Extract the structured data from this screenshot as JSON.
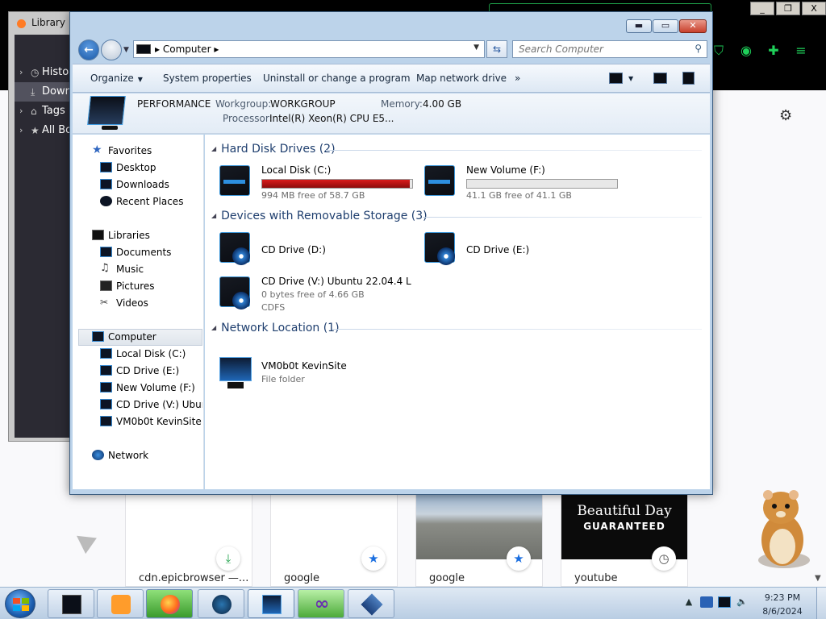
{
  "browser": {
    "library_title": "Library",
    "library_items": [
      "History",
      "Downloads",
      "Tags",
      "All Bookmarks"
    ],
    "tiles": [
      {
        "label": "cdn.epicbrowser —...",
        "badge": "download-icon"
      },
      {
        "label": "google",
        "badge": "star-icon"
      },
      {
        "label": "google",
        "badge": "star-icon"
      },
      {
        "label": "youtube",
        "badge": "clock-icon",
        "thumb_line1": "Beautiful Day",
        "thumb_line2": "GUARANTEED"
      }
    ],
    "window_buttons": [
      "_",
      "❐",
      "X"
    ]
  },
  "explorer": {
    "address": {
      "path": "Computer"
    },
    "search": {
      "placeholder": "Search Computer"
    },
    "toolbar": {
      "organize": "Organize",
      "system_properties": "System properties",
      "uninstall": "Uninstall or change a program",
      "map_drive": "Map network drive",
      "more": "»"
    },
    "details": {
      "computer_name": "PERFORMANCE",
      "workgroup_label": "Workgroup:",
      "workgroup_value": "WORKGROUP",
      "memory_label": "Memory:",
      "memory_value": "4.00 GB",
      "processor_label": "Processor:",
      "processor_value": "Intel(R) Xeon(R) CPU E5..."
    },
    "nav": {
      "favorites": "Favorites",
      "favorites_items": [
        "Desktop",
        "Downloads",
        "Recent Places"
      ],
      "libraries": "Libraries",
      "libraries_items": [
        "Documents",
        "Music",
        "Pictures",
        "Videos"
      ],
      "computer": "Computer",
      "computer_items": [
        "Local Disk (C:)",
        "CD Drive (E:)",
        "New Volume (F:)",
        "CD Drive (V:) Ubuntu",
        "VM0b0t KevinSite"
      ],
      "network": "Network"
    },
    "groups": {
      "hard_disks": "Hard Disk Drives (2)",
      "removable": "Devices with Removable Storage (3)",
      "network": "Network Location (1)"
    },
    "drives": {
      "c": {
        "name": "Local Disk (C:)",
        "free": "994 MB free of 58.7 GB",
        "used_fraction": 0.983,
        "bar_color": "#da1c1c"
      },
      "f": {
        "name": "New Volume (F:)",
        "free": "41.1 GB free of 41.1 GB",
        "used_fraction": 0.0,
        "bar_color": "#26a0da"
      },
      "d": {
        "name": "CD Drive (D:)"
      },
      "e": {
        "name": "CD Drive (E:)"
      },
      "v": {
        "name": "CD Drive (V:) Ubuntu 22.04.4 L",
        "free": "0 bytes free of 4.66 GB",
        "fs": "CDFS"
      }
    },
    "network_location": {
      "name": "VM0b0t KevinSite",
      "type": "File folder"
    }
  },
  "taskbar": {
    "apps": [
      "explorer-icon",
      "media-player-icon",
      "firefox-icon",
      "steam-icon",
      "computer-icon",
      "visual-studio-icon",
      "virtualbox-icon"
    ],
    "clock_time": "9:23 PM",
    "clock_date": "8/6/2024"
  }
}
